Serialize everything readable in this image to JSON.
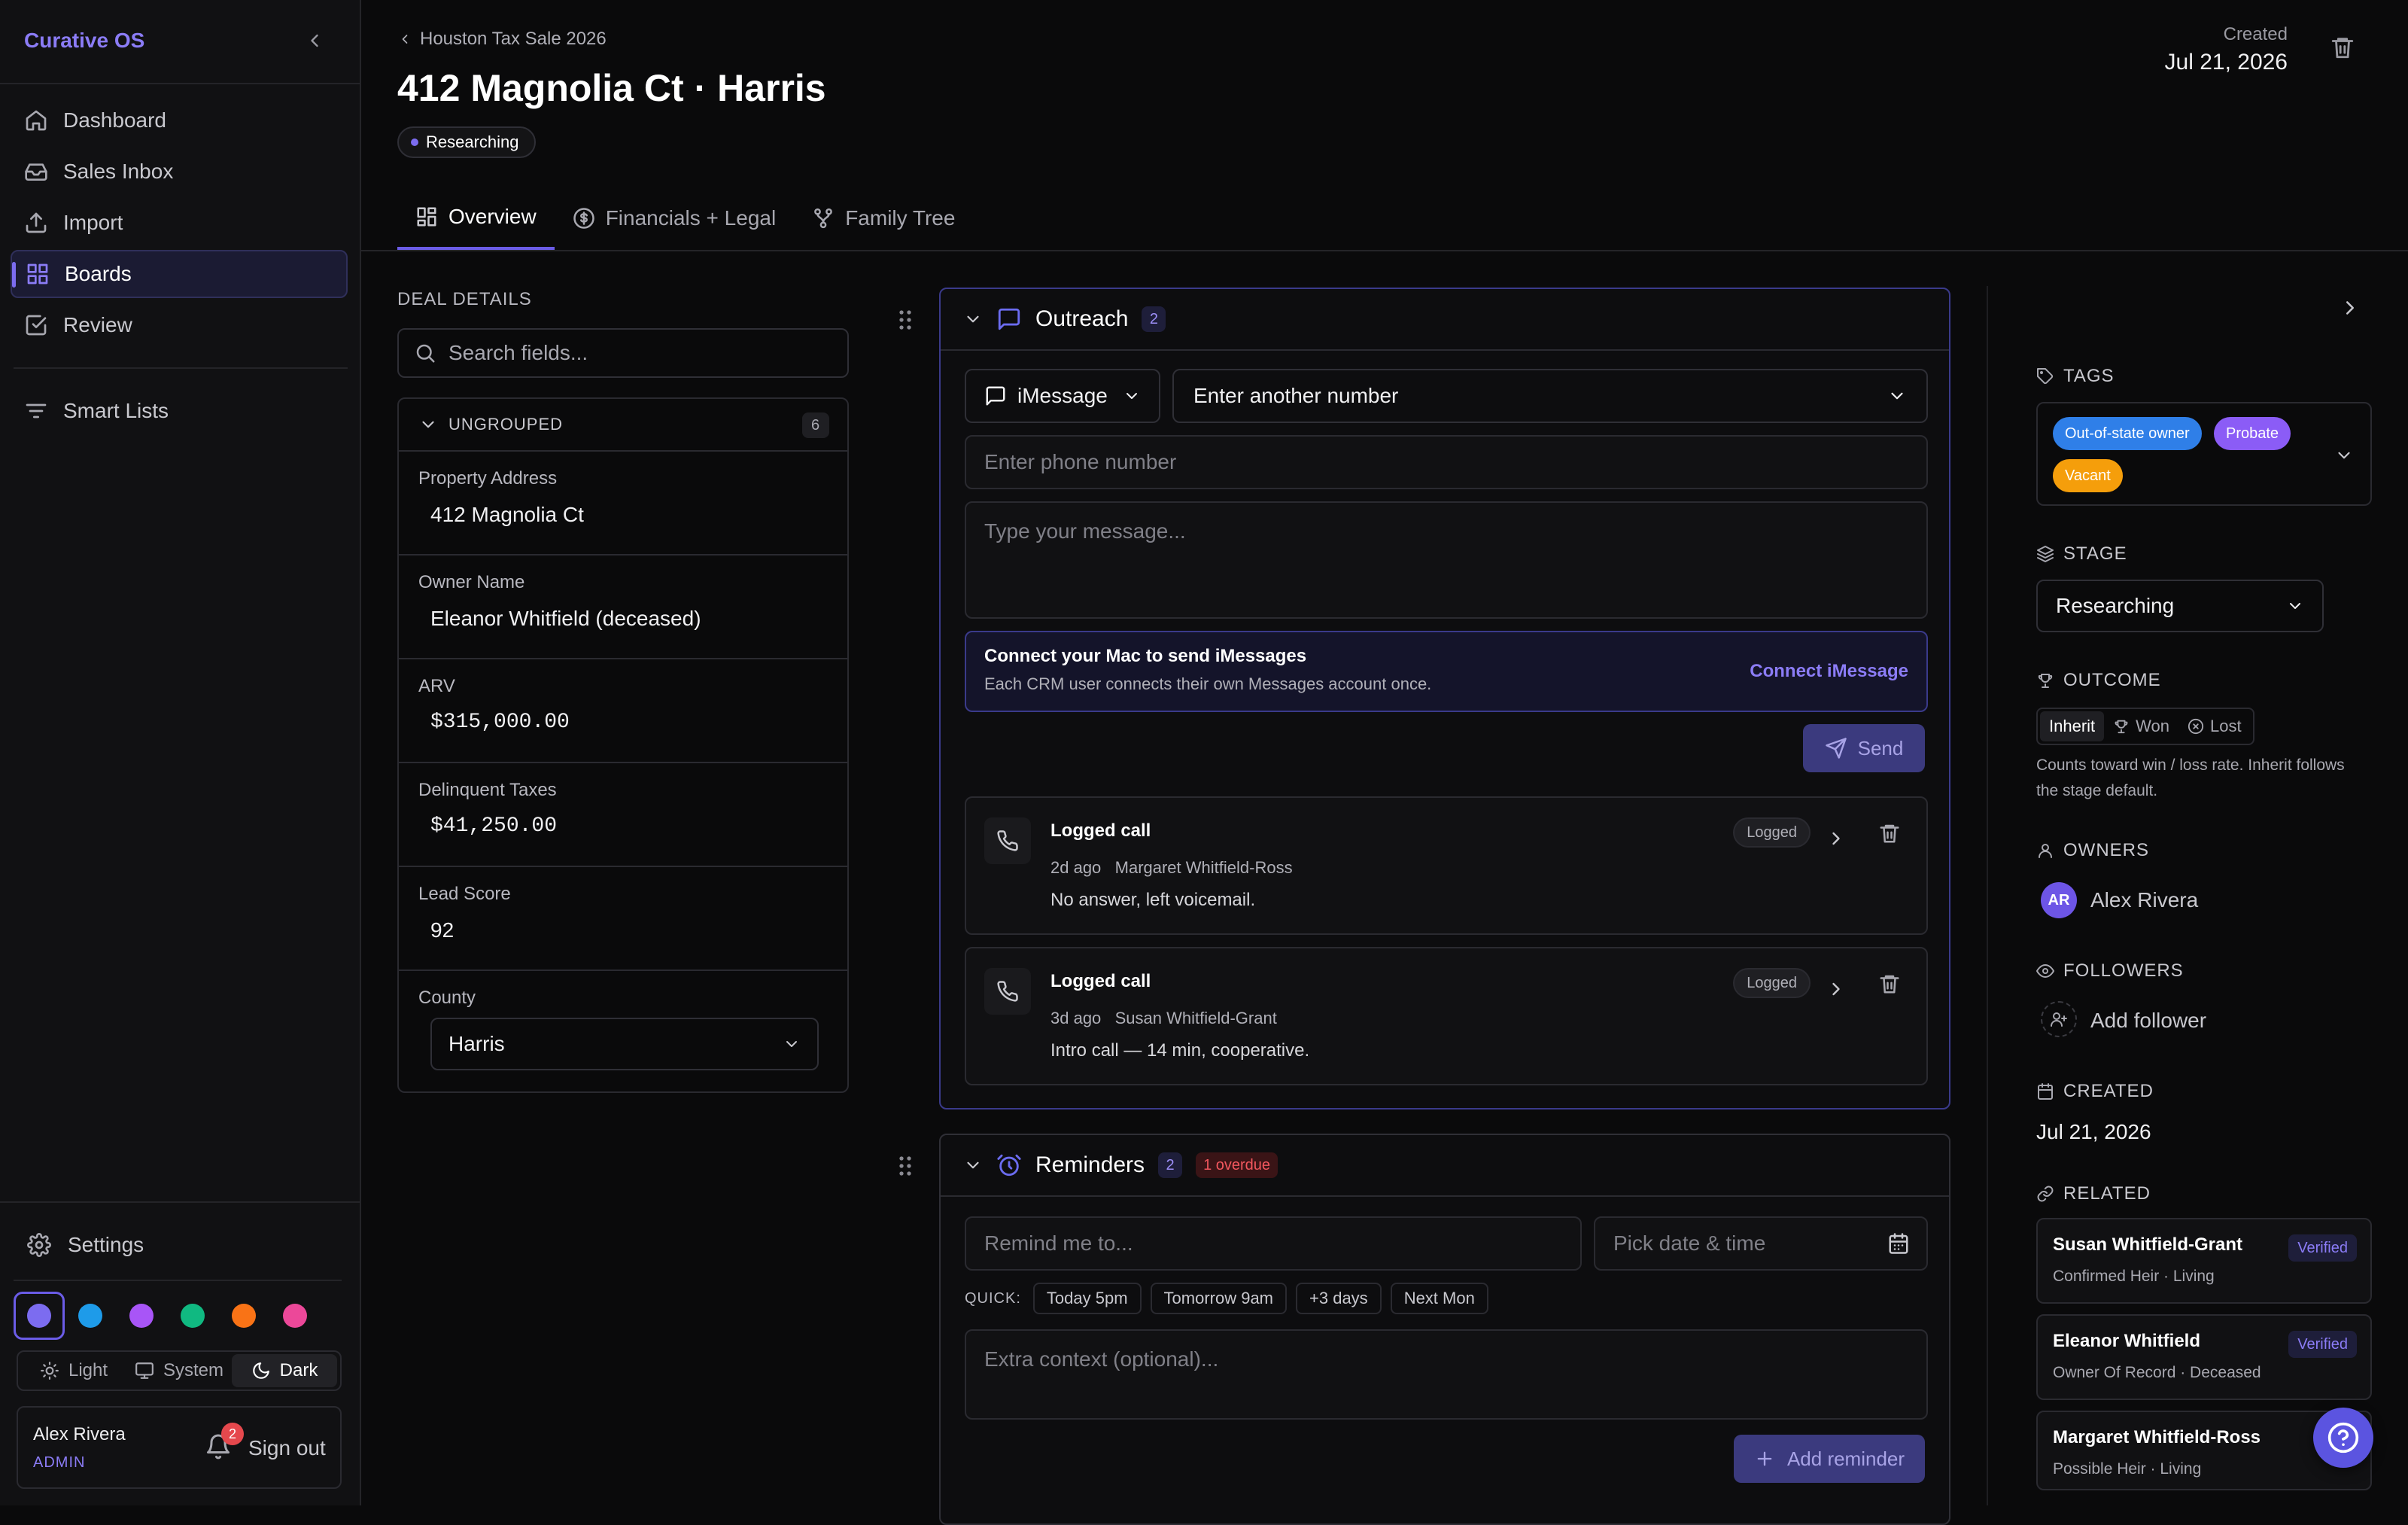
{
  "app": {
    "brand": "Curative OS"
  },
  "sidebar": {
    "items": [
      {
        "label": "Dashboard",
        "icon": "home-icon"
      },
      {
        "label": "Sales Inbox",
        "icon": "inbox-icon"
      },
      {
        "label": "Import",
        "icon": "upload-icon"
      },
      {
        "label": "Boards",
        "icon": "grid-icon",
        "active": true
      },
      {
        "label": "Review",
        "icon": "check-square-icon"
      }
    ],
    "smart_lists": "Smart Lists",
    "settings": "Settings",
    "accent_swatches": [
      "#7c6cf0",
      "#1e9be9",
      "#a855f7",
      "#10b981",
      "#f97316",
      "#ec4899"
    ],
    "theme": {
      "light": "Light",
      "system": "System",
      "dark": "Dark",
      "selected": "Dark"
    },
    "user": {
      "name": "Alex Rivera",
      "role": "ADMIN",
      "notifications": "2",
      "sign_out": "Sign out"
    }
  },
  "header": {
    "breadcrumb": "Houston Tax Sale 2026",
    "title": "412 Magnolia Ct · Harris",
    "status": "Researching",
    "created_label": "Created",
    "created_value": "Jul 21, 2026",
    "tabs": [
      {
        "label": "Overview",
        "icon": "layout-icon",
        "active": true
      },
      {
        "label": "Financials + Legal",
        "icon": "dollar-circle-icon"
      },
      {
        "label": "Family Tree",
        "icon": "git-branch-icon"
      }
    ]
  },
  "deal_details": {
    "heading": "DEAL DETAILS",
    "search_placeholder": "Search fields...",
    "group_label": "UNGROUPED",
    "group_count": "6",
    "fields": [
      {
        "label": "Property Address",
        "value": "412 Magnolia Ct"
      },
      {
        "label": "Owner Name",
        "value": "Eleanor Whitfield (deceased)"
      },
      {
        "label": "ARV",
        "value": "$315,000.00"
      },
      {
        "label": "Delinquent Taxes",
        "value": "$41,250.00"
      },
      {
        "label": "Lead Score",
        "value": "92"
      },
      {
        "label": "County",
        "value": "Harris"
      }
    ]
  },
  "outreach": {
    "title": "Outreach",
    "count": "2",
    "channel": "iMessage",
    "number_select": "Enter another number",
    "phone_placeholder": "Enter phone number",
    "message_placeholder": "Type your message...",
    "connect_title": "Connect your Mac to send iMessages",
    "connect_sub": "Each CRM user connects their own Messages account once.",
    "connect_link": "Connect iMessage",
    "send": "Send",
    "logs": [
      {
        "title": "Logged call",
        "meta": "2d ago   Margaret Whitfield-Ross",
        "body": "No answer, left voicemail.",
        "tag": "Logged"
      },
      {
        "title": "Logged call",
        "meta": "3d ago   Susan Whitfield-Grant",
        "body": "Intro call — 14 min, cooperative.",
        "tag": "Logged"
      }
    ]
  },
  "reminders": {
    "title": "Reminders",
    "count": "2",
    "overdue": "1 overdue",
    "remind_placeholder": "Remind me to...",
    "date_placeholder": "Pick date & time",
    "quick_label": "QUICK:",
    "quick": [
      "Today 5pm",
      "Tomorrow 9am",
      "+3 days",
      "Next Mon"
    ],
    "context_placeholder": "Extra context (optional)...",
    "add": "Add reminder"
  },
  "right": {
    "tags_label": "TAGS",
    "tags": [
      {
        "label": "Out-of-state owner",
        "color": "#2f7fe8"
      },
      {
        "label": "Probate",
        "color": "#8b5cf6"
      },
      {
        "label": "Vacant",
        "color": "#f59e0b"
      }
    ],
    "stage_label": "STAGE",
    "stage": "Researching",
    "outcome_label": "OUTCOME",
    "outcome": {
      "inherit": "Inherit",
      "won": "Won",
      "lost": "Lost"
    },
    "outcome_note": "Counts toward win / loss rate. Inherit follows the stage default.",
    "owners_label": "OWNERS",
    "owner": {
      "initials": "AR",
      "name": "Alex Rivera"
    },
    "followers_label": "FOLLOWERS",
    "add_follower": "Add follower",
    "created_label": "CREATED",
    "created": "Jul 21, 2026",
    "related_label": "RELATED",
    "related": [
      {
        "name": "Susan Whitfield-Grant",
        "sub": "Confirmed Heir · Living",
        "badge": "Verified"
      },
      {
        "name": "Eleanor Whitfield",
        "sub": "Owner Of Record · Deceased",
        "badge": "Verified"
      },
      {
        "name": "Margaret Whitfield-Ross",
        "sub": "Possible Heir · Living",
        "badge": ""
      }
    ]
  }
}
